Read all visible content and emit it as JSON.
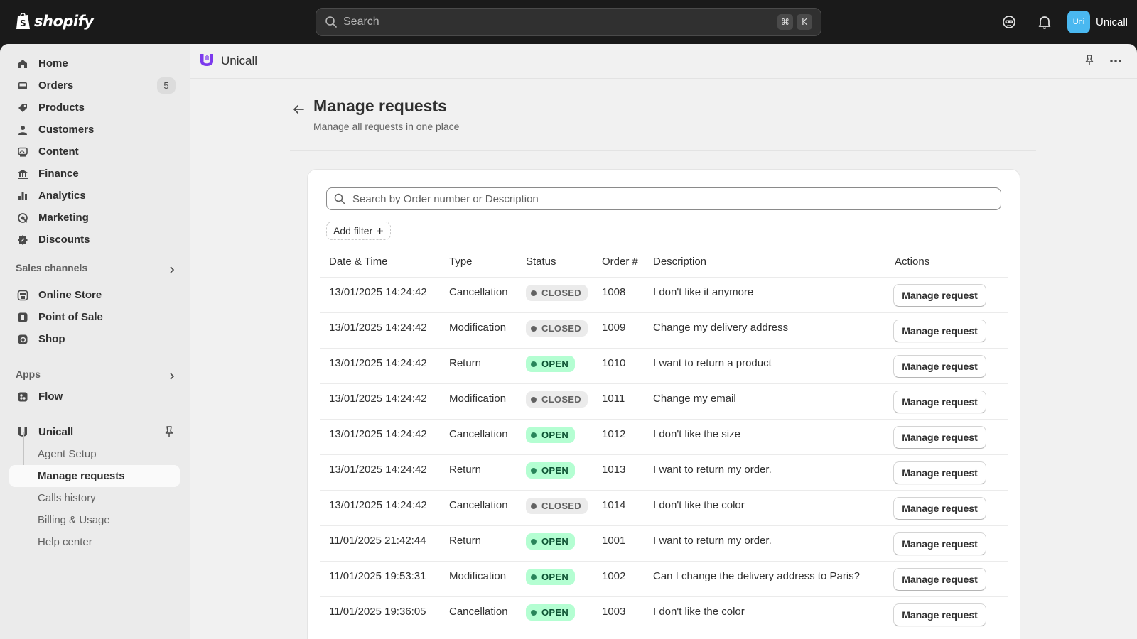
{
  "topbar": {
    "brand": "shopify",
    "search_placeholder": "Search",
    "shortcut_keys": [
      "⌘",
      "K"
    ],
    "store_avatar": "Uni",
    "store_name": "Unicall"
  },
  "sidebar": {
    "main_items": [
      {
        "label": "Home",
        "icon": "home-icon"
      },
      {
        "label": "Orders",
        "icon": "orders-icon",
        "badge": "5"
      },
      {
        "label": "Products",
        "icon": "tag-icon"
      },
      {
        "label": "Customers",
        "icon": "person-icon"
      },
      {
        "label": "Content",
        "icon": "content-icon"
      },
      {
        "label": "Finance",
        "icon": "bank-icon"
      },
      {
        "label": "Analytics",
        "icon": "bar-chart-icon"
      },
      {
        "label": "Marketing",
        "icon": "target-icon"
      },
      {
        "label": "Discounts",
        "icon": "discount-icon"
      }
    ],
    "sales_channels_header": "Sales channels",
    "sales_channels": [
      {
        "label": "Online Store",
        "icon": "store-icon"
      },
      {
        "label": "Point of Sale",
        "icon": "pos-icon"
      },
      {
        "label": "Shop",
        "icon": "shop-icon"
      }
    ],
    "apps_header": "Apps",
    "apps": [
      {
        "label": "Flow",
        "icon": "flow-icon"
      }
    ],
    "unicall": {
      "label": "Unicall",
      "sub_items": [
        "Agent Setup",
        "Manage requests",
        "Calls history",
        "Billing & Usage",
        "Help center"
      ],
      "active": "Manage requests"
    }
  },
  "appbar": {
    "title": "Unicall"
  },
  "page": {
    "title": "Manage requests",
    "subtitle": "Manage all requests in one place",
    "search_placeholder": "Search by Order number or Description",
    "add_filter": "Add filter"
  },
  "table": {
    "headers": [
      "Date & Time",
      "Type",
      "Status",
      "Order #",
      "Description",
      "Actions"
    ],
    "action_label": "Manage request",
    "rows": [
      {
        "datetime": "13/01/2025 14:24:42",
        "type": "Cancellation",
        "status": "CLOSED",
        "order": "1008",
        "description": "I don't like it anymore"
      },
      {
        "datetime": "13/01/2025 14:24:42",
        "type": "Modification",
        "status": "CLOSED",
        "order": "1009",
        "description": "Change my delivery address"
      },
      {
        "datetime": "13/01/2025 14:24:42",
        "type": "Return",
        "status": "OPEN",
        "order": "1010",
        "description": "I want to return a product"
      },
      {
        "datetime": "13/01/2025 14:24:42",
        "type": "Modification",
        "status": "CLOSED",
        "order": "1011",
        "description": "Change my email"
      },
      {
        "datetime": "13/01/2025 14:24:42",
        "type": "Cancellation",
        "status": "OPEN",
        "order": "1012",
        "description": "I don't like the size"
      },
      {
        "datetime": "13/01/2025 14:24:42",
        "type": "Return",
        "status": "OPEN",
        "order": "1013",
        "description": "I want to return my order."
      },
      {
        "datetime": "13/01/2025 14:24:42",
        "type": "Cancellation",
        "status": "CLOSED",
        "order": "1014",
        "description": "I don't like the color"
      },
      {
        "datetime": "11/01/2025 21:42:44",
        "type": "Return",
        "status": "OPEN",
        "order": "1001",
        "description": "I want to return my order."
      },
      {
        "datetime": "11/01/2025 19:53:31",
        "type": "Modification",
        "status": "OPEN",
        "order": "1002",
        "description": "Can I change the delivery address to Paris?"
      },
      {
        "datetime": "11/01/2025 19:36:05",
        "type": "Cancellation",
        "status": "OPEN",
        "order": "1003",
        "description": "I don't like the color"
      }
    ]
  },
  "colors": {
    "topbar_bg": "#1a1a1a",
    "open_badge_bg": "#b4fed2",
    "open_badge_text": "#0c5132",
    "closed_badge_bg": "#ebebeb",
    "app_accent": "#7c3aed"
  }
}
